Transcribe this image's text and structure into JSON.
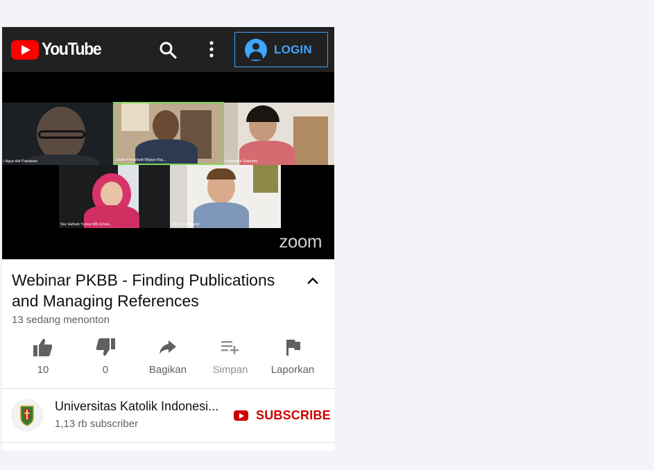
{
  "header": {
    "logo_text": "YouTube",
    "login_label": "LOGIN"
  },
  "video": {
    "brand_watermark": "zoom",
    "participants": [
      {
        "name": "I Agus Adi Putrawan"
      },
      {
        "name": "Gede Primahadi Wijaya Raj..."
      },
      {
        "name": "Katharina Sukamto"
      },
      {
        "name": "Nur Hafsah Yunus MS (Unas..."
      },
      {
        "name": "Joey Lovestrand"
      }
    ]
  },
  "info": {
    "title": "Webinar PKBB - Finding Publications and Managing References",
    "views": "13 sedang menonton"
  },
  "actions": {
    "like_count": "10",
    "dislike_count": "0",
    "share_label": "Bagikan",
    "save_label": "Simpan",
    "report_label": "Laporkan"
  },
  "channel": {
    "name": "Universitas Katolik Indonesi...",
    "subscribers": "1,13 rb subscriber",
    "subscribe_label": "SUBSCRIBE"
  },
  "colors": {
    "header_bg": "#212121",
    "accent_blue": "#3ea6ff",
    "youtube_red": "#ff0000",
    "subscribe_red": "#cc0000"
  }
}
